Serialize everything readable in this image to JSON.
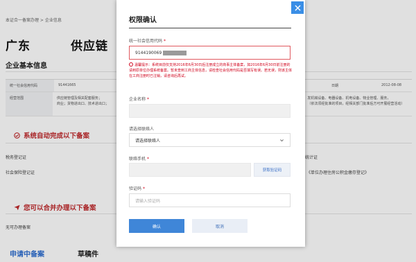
{
  "background": {
    "breadcrumb": "本证合一备案办理 > 企业信息",
    "company_name_left": "广东",
    "company_name_right": "供应链",
    "basic_info_title": "企业基本信息",
    "table": {
      "row1": [
        "统一社会信用代码",
        "91441665",
        "",
        "日期",
        "2012-08-08"
      ],
      "row2_label": "经营范围",
      "row2_left": "供应链管理及相关配套服务；",
      "row2_left2": "商业；货物进出口、技术进出口；",
      "row2_right": "发机械设备、电器设备、机电设备、物业管理、服务，",
      "row2_right2": "（依法须经批准的项目，经相关部门批准后方可开展经营活动）"
    },
    "auto_done_title": "系统自动完成以下备案",
    "auto_items": [
      "税务登记证",
      "社会保险登记证"
    ],
    "right_items": [
      "统计证",
      "《单位办理住房公积金缴存登记》"
    ],
    "optional_title": "您可以合并办理以下备案",
    "optional_item": "无可办理备案",
    "tabs": [
      "申请中备案",
      "草稿件"
    ]
  },
  "modal": {
    "title": "权限确认",
    "credit_code": {
      "label": "统一社会信用代码",
      "required_mark": "*",
      "value": "9144190069"
    },
    "warning": "温馨提示：系统目前仅支持2016年6月30日后注册成立的商事主体备案，如2016年6月30日前注册的请到原单位办理系统备案。暂未查到工商主体信息，请检查社会信用代码是否填写有误。若无误，则该主体在工商注册时已注销，请咨询后再试。",
    "company_name": {
      "label": "企业名称",
      "required_mark": "*",
      "value": ""
    },
    "contact": {
      "label": "请选择联络人",
      "value": "请选择联络人"
    },
    "phone": {
      "label": "联络手机",
      "required_mark": "*",
      "value": ""
    },
    "get_code_button": "获取验证码",
    "code": {
      "label": "验证码",
      "required_mark": "*",
      "placeholder": "请输入验证码"
    },
    "confirm_button": "确认",
    "cancel_button": "取消"
  },
  "colors": {
    "accent_blue": "#3f86d8",
    "error_red": "#d0021b",
    "section_red": "#c0282b"
  },
  "icons": {
    "close": "close-icon",
    "chevron": "chevron-down-icon",
    "warning": "warning-circle-icon",
    "check": "check-circle-icon",
    "paper_plane": "send-icon"
  }
}
